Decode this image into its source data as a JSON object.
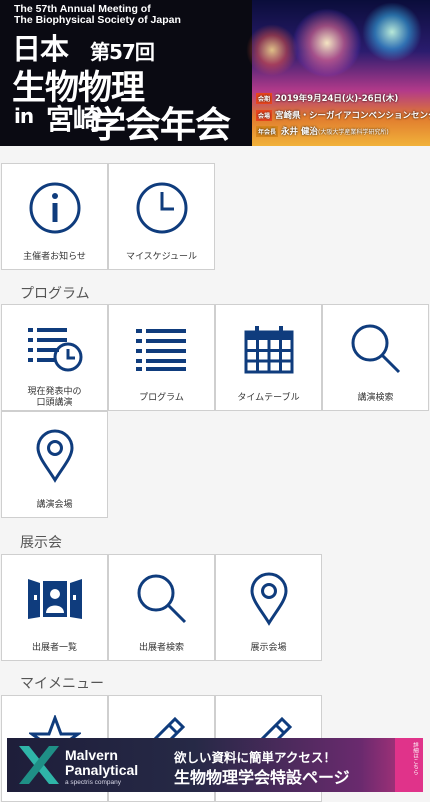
{
  "banner": {
    "english_title_1": "The 57th Annual Meeting of",
    "english_title_2": "The Biophysical Society of Japan",
    "jp_line1": "日本",
    "edition": "第57回",
    "jp_line2": "生物物理",
    "in": "in",
    "place": "宮崎",
    "jp_line3": "学会年会",
    "tag_date": "会期",
    "date": "2019年9月24日(火)-26日(木)",
    "tag_venue": "会場",
    "venue": "宮崎県・シーガイアコンベンションセンター",
    "tag_chair": "年会長",
    "chair": "永井 健治",
    "chair_affil": "(大阪大学産業科学研究所)"
  },
  "top_tiles": [
    {
      "label": "主催者お知らせ",
      "icon": "info-icon"
    },
    {
      "label": "マイスケジュール",
      "icon": "clock-icon"
    }
  ],
  "sections": {
    "program": {
      "title": "プログラム",
      "tiles": [
        {
          "label": "現在発表中の\n口頭講演",
          "icon": "list-clock-icon"
        },
        {
          "label": "プログラム",
          "icon": "list-icon"
        },
        {
          "label": "タイムテーブル",
          "icon": "calendar-icon"
        },
        {
          "label": "講演検索",
          "icon": "search-icon"
        },
        {
          "label": "講演会場",
          "icon": "map-pin-icon"
        }
      ]
    },
    "exhibition": {
      "title": "展示会",
      "tiles": [
        {
          "label": "出展者一覧",
          "icon": "exhibitor-booth-icon"
        },
        {
          "label": "出展者検索",
          "icon": "search-icon"
        },
        {
          "label": "展示会場",
          "icon": "map-pin-icon"
        }
      ]
    },
    "my_menu": {
      "title": "マイメニュー",
      "tiles": [
        {
          "icon": "star-icon"
        },
        {
          "icon": "pencil-icon"
        },
        {
          "icon": "pencil-icon"
        }
      ]
    }
  },
  "ad": {
    "brand_line1": "Malvern",
    "brand_line2": "Panalytical",
    "brand_sub": "a spectris company",
    "line1": "欲しい資料に簡単アクセス！",
    "line2": "生物物理学会特設ページ",
    "ribbon": "詳細はこちら"
  },
  "colors": {
    "icon_blue": "#0f3c7d",
    "tile_bg": "#ffffff",
    "page_bg": "#f5f5f5"
  }
}
